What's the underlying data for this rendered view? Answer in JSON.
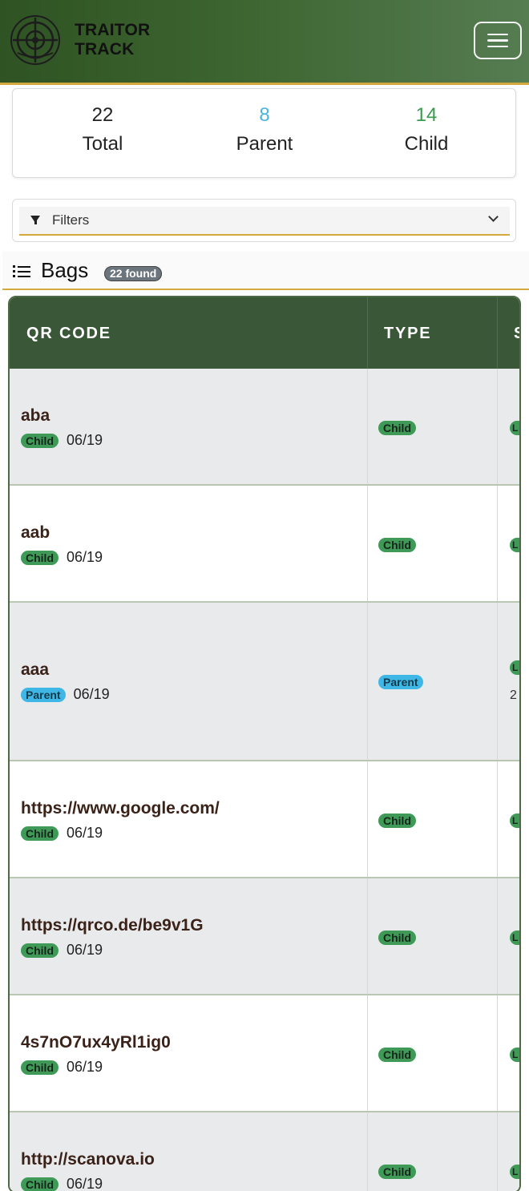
{
  "app": {
    "brand_line1": "TRAITOR",
    "brand_line2": "TRACK"
  },
  "stats": [
    {
      "value": "22",
      "label": "Total",
      "color": "#222222"
    },
    {
      "value": "8",
      "label": "Parent",
      "color": "#4ab4e0"
    },
    {
      "value": "14",
      "label": "Child",
      "color": "#3a9a4e"
    }
  ],
  "filters": {
    "label": "Filters",
    "icon": "funnel-icon"
  },
  "bags": {
    "title": "Bags",
    "found_badge": "22 found",
    "icon": "list-icon"
  },
  "table": {
    "columns": [
      "QR CODE",
      "TYPE",
      "S"
    ],
    "rows": [
      {
        "qr": "aba",
        "type": "Child",
        "date": "06/19",
        "status_peek": "L"
      },
      {
        "qr": "aab",
        "type": "Child",
        "date": "06/19",
        "status_peek": "L"
      },
      {
        "qr": "aaa",
        "type": "Parent",
        "date": "06/19",
        "status_peek": "L",
        "extra_peek": "2"
      },
      {
        "qr": "https://www.google.com/",
        "type": "Child",
        "date": "06/19",
        "status_peek": "L"
      },
      {
        "qr": "https://qrco.de/be9v1G",
        "type": "Child",
        "date": "06/19",
        "status_peek": "L"
      },
      {
        "qr": "4s7nO7ux4yRl1ig0",
        "type": "Child",
        "date": "06/19",
        "status_peek": "L"
      },
      {
        "qr": "http://scanova.io",
        "type": "Child",
        "date": "06/19",
        "status_peek": "L"
      }
    ]
  },
  "colors": {
    "header_dark": "#2f5323",
    "accent_gold": "#d4a83a",
    "table_head": "#3a5838",
    "child_badge": "#3f9a58",
    "parent_badge": "#3fb7e6"
  }
}
